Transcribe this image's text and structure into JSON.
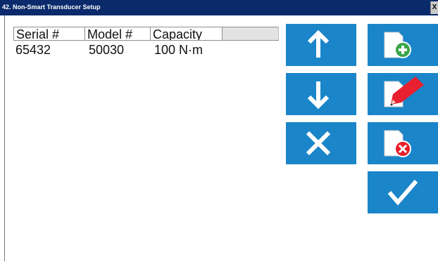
{
  "window": {
    "title": "42. Non-Smart Transducer Setup",
    "close_label": "X"
  },
  "table": {
    "columns": [
      "Serial #",
      "Model #",
      "Capacity"
    ],
    "rows": [
      {
        "serial": "65432",
        "model": "50030",
        "capacity": "100 N·m"
      }
    ]
  },
  "buttons": {
    "move_up": "arrow-up-icon",
    "move_down": "arrow-down-icon",
    "remove": "x-icon",
    "add": "document-add-icon",
    "edit": "document-edit-icon",
    "delete": "document-delete-icon",
    "confirm": "checkmark-icon"
  },
  "colors": {
    "title_bar": "#0a2a6b",
    "button_blue": "#1a85c9",
    "add_green": "#3aa64a",
    "delete_red": "#e8202a",
    "edit_red": "#e82030"
  }
}
